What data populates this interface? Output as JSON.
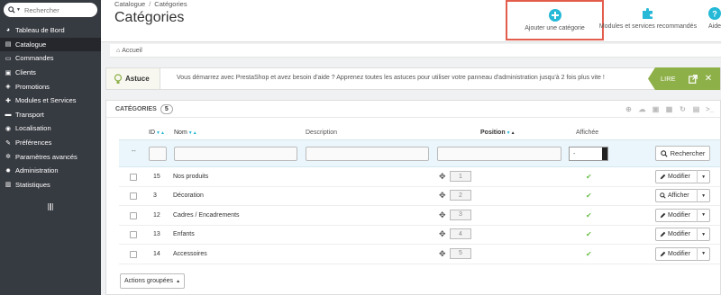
{
  "search": {
    "placeholder": "Rechercher"
  },
  "sidebar": {
    "items": [
      {
        "label": "Tableau de Bord",
        "icon": "dashboard-icon",
        "glyph": "◕"
      },
      {
        "label": "Catalogue",
        "icon": "book-icon",
        "glyph": "▤",
        "active": true
      },
      {
        "label": "Commandes",
        "icon": "credit-card-icon",
        "glyph": "▭"
      },
      {
        "label": "Clients",
        "icon": "user-icon",
        "glyph": "▣"
      },
      {
        "label": "Promotions",
        "icon": "megaphone-icon",
        "glyph": "◈"
      },
      {
        "label": "Modules et Services",
        "icon": "puzzle-icon",
        "glyph": "✚"
      },
      {
        "label": "Transport",
        "icon": "truck-icon",
        "glyph": "▬"
      },
      {
        "label": "Localisation",
        "icon": "globe-icon",
        "glyph": "◉"
      },
      {
        "label": "Préférences",
        "icon": "wrench-icon",
        "glyph": "✎"
      },
      {
        "label": "Paramètres avancés",
        "icon": "cogs-icon",
        "glyph": "✲"
      },
      {
        "label": "Administration",
        "icon": "gear-icon",
        "glyph": "✹"
      },
      {
        "label": "Statistiques",
        "icon": "bar-chart-icon",
        "glyph": "▥"
      }
    ]
  },
  "header": {
    "breadcrumb": [
      "Catalogue",
      "Catégories"
    ],
    "breadcrumb_sep": "/",
    "title": "Catégories",
    "toolbar": {
      "add_label": "Ajouter une catégorie",
      "modules_label": "Modules et services recommandés",
      "help_label": "Aide"
    }
  },
  "subbar": {
    "home_label": "Accueil"
  },
  "tip": {
    "label": "Astuce",
    "text": "Vous démarrez avec PrestaShop et avez besoin d'aide ? Apprenez toutes les astuces pour utiliser votre panneau d'administration jusqu'à 2 fois plus vite !",
    "button_label": "LIRE",
    "close_glyph": "✕"
  },
  "panel": {
    "title": "CATÉGORIES",
    "count": "5",
    "columns": {
      "id": "ID",
      "name": "Nom",
      "description": "Description",
      "position": "Position",
      "displayed": "Affichée"
    },
    "filter": {
      "dash": "--",
      "select_value": "-",
      "search_button": "Rechercher"
    },
    "rows": [
      {
        "id": "15",
        "name": "Nos produits",
        "position": "1",
        "action": "Modifier"
      },
      {
        "id": "3",
        "name": "Décoration",
        "position": "2",
        "action": "Afficher"
      },
      {
        "id": "12",
        "name": "Cadres / Encadrements",
        "position": "3",
        "action": "Modifier"
      },
      {
        "id": "13",
        "name": "Enfants",
        "position": "4",
        "action": "Modifier"
      },
      {
        "id": "14",
        "name": "Accessoires",
        "position": "5",
        "action": "Modifier"
      }
    ],
    "bulk_label": "Actions groupées"
  },
  "colors": {
    "sidebar_bg": "#363a41",
    "accent": "#25b9d7",
    "highlight_border": "#e35d4c",
    "lire_bg": "#8eb049",
    "check": "#6bbf4b"
  }
}
